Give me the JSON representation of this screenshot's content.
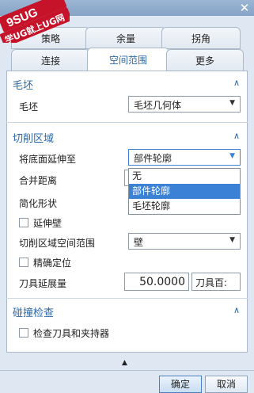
{
  "window": {
    "title_partial": "文",
    "close_glyph": "✕"
  },
  "watermark": {
    "line1": "9SUG",
    "line2": "学UG就上UG网"
  },
  "tabs": {
    "row1": [
      "策略",
      "余量",
      "拐角"
    ],
    "row2": [
      "连接",
      "空间范围",
      "更多"
    ],
    "active": "空间范围"
  },
  "sections": {
    "blank": {
      "title": "毛坯",
      "caret": "∧",
      "label": "毛坯",
      "select_value": "毛坯几何体"
    },
    "cut_region": {
      "title": "切削区域",
      "caret": "∧",
      "extend_floor_label": "将底面延伸至",
      "extend_floor_value": "部件轮廓",
      "merge_distance_label": "合并距离",
      "simplify_shape_label": "简化形状",
      "extend_wall_label": "延伸壁",
      "cut_region_space_label": "切削区域空间范围",
      "cut_region_space_value": "壁",
      "precise_position_label": "精确定位",
      "tool_extension_label": "刀具延展量",
      "tool_extension_value": "50.0000",
      "tool_extension_unit": "刀具百:"
    },
    "collision": {
      "title": "碰撞检查",
      "caret": "∧",
      "check_tool_label": "检查刀具和夹持器"
    }
  },
  "dropdown": {
    "options": [
      "无",
      "部件轮廓",
      "毛坯轮廓"
    ],
    "selected": "部件轮廓"
  },
  "collapse_glyph": "▲",
  "buttons": {
    "ok": "确定",
    "cancel": "取消"
  }
}
